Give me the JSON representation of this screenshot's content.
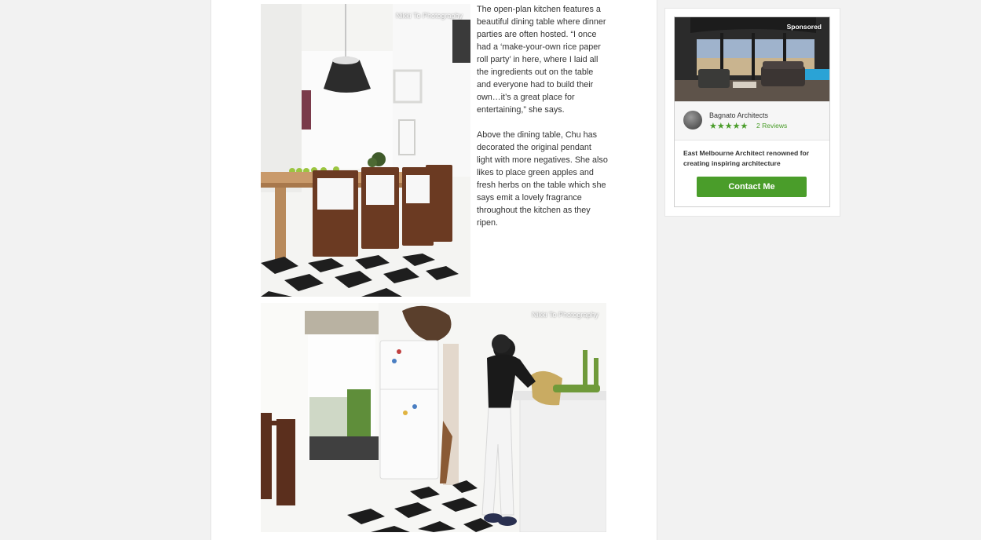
{
  "article": {
    "photo_1_credit": "Nikki To Photography",
    "photo_2_credit": "Nikki To Photography",
    "paragraphs": [
      "The open-plan kitchen features a beautiful dining table where dinner parties are often hosted. “I once had a ‘make-your-own rice paper roll party’ in here, where I laid all the ingredients out on the table and everyone had to build their own…it’s a great place for entertaining,” she says.",
      "Above the dining table, Chu has decorated the original pendant light with more negatives. She also likes to place green apples and fresh herbs on the table which she says emit a lovely fragrance throughout the kitchen as they ripen."
    ]
  },
  "ad": {
    "sponsored_label": "Sponsored",
    "pro_name": "Bagnato Architects",
    "rating_stars": 5,
    "stars_display": "★★★★★",
    "reviews_label": "2 Reviews",
    "description": "East Melbourne Architect renowned for creating inspiring architecture",
    "cta_label": "Contact Me"
  },
  "colors": {
    "brand_green": "#4a9d2a",
    "page_bg": "#f2f2f2"
  }
}
